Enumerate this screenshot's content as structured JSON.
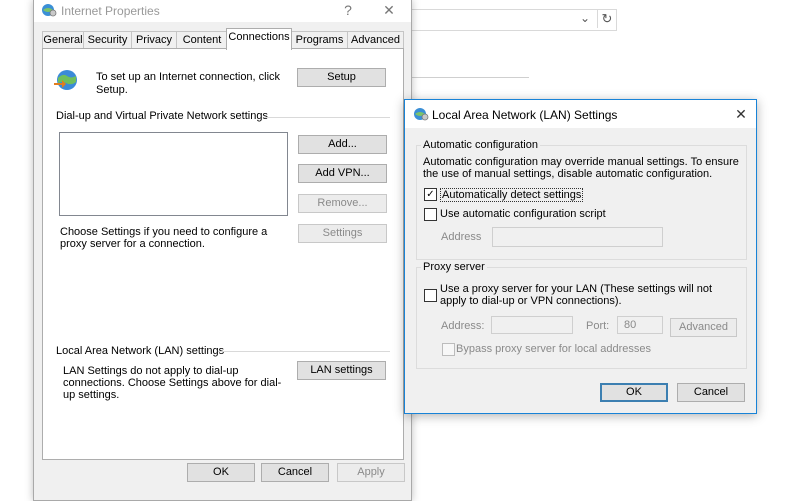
{
  "background": {
    "refresh_icon": "refresh-icon",
    "dropdown_icon": "chevron-down-icon"
  },
  "internet_properties": {
    "title": "Internet Properties",
    "help_label": "?",
    "close_label": "✕",
    "tabs": [
      "General",
      "Security",
      "Privacy",
      "Content",
      "Connections",
      "Programs",
      "Advanced"
    ],
    "active_tab": "Connections",
    "setup_text": "To set up an Internet connection, click Setup.",
    "setup_button": "Setup",
    "dialup_heading": "Dial-up and Virtual Private Network settings",
    "add_button": "Add...",
    "add_vpn_button": "Add VPN...",
    "remove_button": "Remove...",
    "settings_text": "Choose Settings if you need to configure a proxy server for a connection.",
    "settings_button": "Settings",
    "lan_heading": "Local Area Network (LAN) settings",
    "lan_text": "LAN Settings do not apply to dial-up connections. Choose Settings above for dial-up settings.",
    "lan_button": "LAN settings",
    "ok_button": "OK",
    "cancel_button": "Cancel",
    "apply_button": "Apply"
  },
  "lan_dialog": {
    "title": "Local Area Network (LAN) Settings",
    "close_label": "✕",
    "auto_config_heading": "Automatic configuration",
    "auto_config_text": "Automatic configuration may override manual settings.  To ensure the use of manual settings, disable automatic configuration.",
    "auto_detect_label": "Automatically detect settings",
    "auto_detect_checked": true,
    "use_script_label": "Use automatic configuration script",
    "use_script_checked": false,
    "script_address_label": "Address",
    "script_address_value": "",
    "proxy_heading": "Proxy server",
    "use_proxy_label": "Use a proxy server for your LAN (These settings will not apply to dial-up or VPN connections).",
    "use_proxy_checked": false,
    "proxy_address_label": "Address:",
    "proxy_address_value": "",
    "port_label": "Port:",
    "port_value": "80",
    "advanced_button": "Advanced",
    "bypass_label": "Bypass proxy server for local addresses",
    "bypass_checked": false,
    "ok_button": "OK",
    "cancel_button": "Cancel"
  }
}
